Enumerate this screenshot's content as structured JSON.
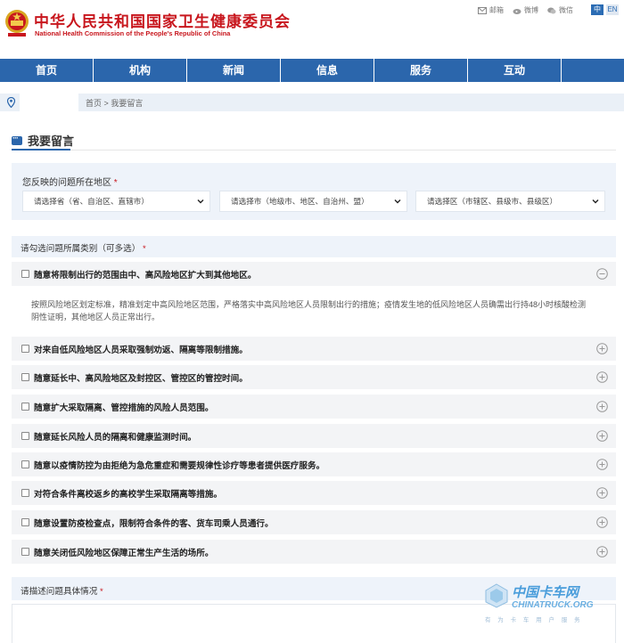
{
  "header": {
    "title_cn": "中华人民共和国国家卫生健康委员会",
    "title_en": "National Health Commission of the People's Republic of China",
    "top_links": [
      {
        "label": "邮箱",
        "icon": "mail-icon"
      },
      {
        "label": "微博",
        "icon": "weibo-icon"
      },
      {
        "label": "微信",
        "icon": "wechat-icon"
      }
    ],
    "lang_zh": "中",
    "lang_en": "EN"
  },
  "nav": {
    "items": [
      "首页",
      "机构",
      "新闻",
      "信息",
      "服务",
      "互动"
    ]
  },
  "breadcrumb": {
    "home": "首页",
    "separator": ">",
    "current": "我要留言"
  },
  "section": {
    "title": "我要留言"
  },
  "region": {
    "label": "您反映的问题所在地区",
    "required_mark": "*",
    "selects": [
      "请选择省（省、自治区、直辖市）",
      "请选择市（地级市、地区、自治州、盟）",
      "请选择区（市辖区、县级市、县级区）"
    ]
  },
  "categories": {
    "label": "请勾选问题所属类别（可多选）",
    "required_mark": "*",
    "items": [
      {
        "text": "随意将限制出行的范围由中、高风险地区扩大到其他地区。",
        "expanded": true,
        "detail": "按照风险地区划定标准，精准划定中高风险地区范围，严格落实中高风险地区人员限制出行的措施；疫情发生地的低风险地区人员确需出行持48小时核酸检测阴性证明，其他地区人员正常出行。"
      },
      {
        "text": "对来自低风险地区人员采取强制劝返、隔离等限制措施。",
        "expanded": false
      },
      {
        "text": "随意延长中、高风险地区及封控区、管控区的管控时间。",
        "expanded": false
      },
      {
        "text": "随意扩大采取隔离、管控措施的风险人员范围。",
        "expanded": false
      },
      {
        "text": "随意延长风险人员的隔离和健康监测时间。",
        "expanded": false
      },
      {
        "text": "随意以疫情防控为由拒绝为急危重症和需要规律性诊疗等患者提供医疗服务。",
        "expanded": false
      },
      {
        "text": "对符合条件离校返乡的高校学生采取隔离等措施。",
        "expanded": false
      },
      {
        "text": "随意设置防疫检查点，限制符合条件的客、货车司乘人员通行。",
        "expanded": false
      },
      {
        "text": "随意关闭低风险地区保障正常生产生活的场所。",
        "expanded": false
      }
    ]
  },
  "details": {
    "label": "请描述问题具体情况",
    "required_mark": "*"
  },
  "watermark": {
    "cn": "中国卡车网",
    "en": "CHINATRUCK.ORG",
    "sub": "有 为 卡 车 用 户 服 务"
  },
  "colors": {
    "brand_red": "#c8161d",
    "nav_blue": "#2b66ac",
    "panel_bg": "#eef3fa"
  }
}
